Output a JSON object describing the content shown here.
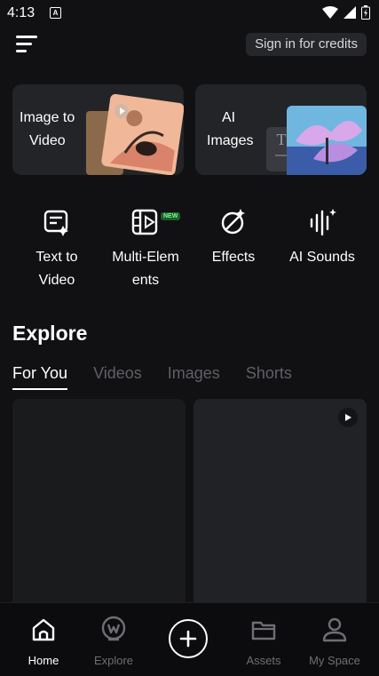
{
  "status_bar": {
    "time": "4:13",
    "notification_glyph": "A",
    "icons": [
      "wifi-icon",
      "signal-icon",
      "battery-icon"
    ]
  },
  "header": {
    "signin_label": "Sign in for credits"
  },
  "cards": [
    {
      "id": "image-to-video",
      "line1": "Image to",
      "line2": "Video"
    },
    {
      "id": "ai-images",
      "line1": "AI",
      "line2": "Images",
      "preview_glyph": "T"
    }
  ],
  "tools": [
    {
      "line1": "Text to",
      "line2": "Video",
      "icon": "text-to-video-icon"
    },
    {
      "line1": "Multi-Elem",
      "line2": "ents",
      "icon": "multi-elements-icon",
      "badge": "NEW"
    },
    {
      "line1": "Effects",
      "line2": "",
      "icon": "effects-icon"
    },
    {
      "line1": "AI Sounds",
      "line2": "",
      "icon": "ai-sounds-icon"
    }
  ],
  "explore": {
    "title": "Explore",
    "tabs": [
      "For You",
      "Videos",
      "Images",
      "Shorts"
    ],
    "active_tab": "For You"
  },
  "nav": {
    "items": [
      {
        "label": "Home",
        "icon": "home-icon",
        "active": true
      },
      {
        "label": "Explore",
        "icon": "explore-icon",
        "active": false
      },
      {
        "label": "",
        "icon": "plus-icon",
        "active": false
      },
      {
        "label": "Assets",
        "icon": "folder-icon",
        "active": false
      },
      {
        "label": "My Space",
        "icon": "profile-icon",
        "active": false
      }
    ]
  },
  "colors": {
    "background": "#111113",
    "card": "#232427",
    "badge_bg": "#1f5c2e",
    "badge_text": "#7dff8a"
  }
}
